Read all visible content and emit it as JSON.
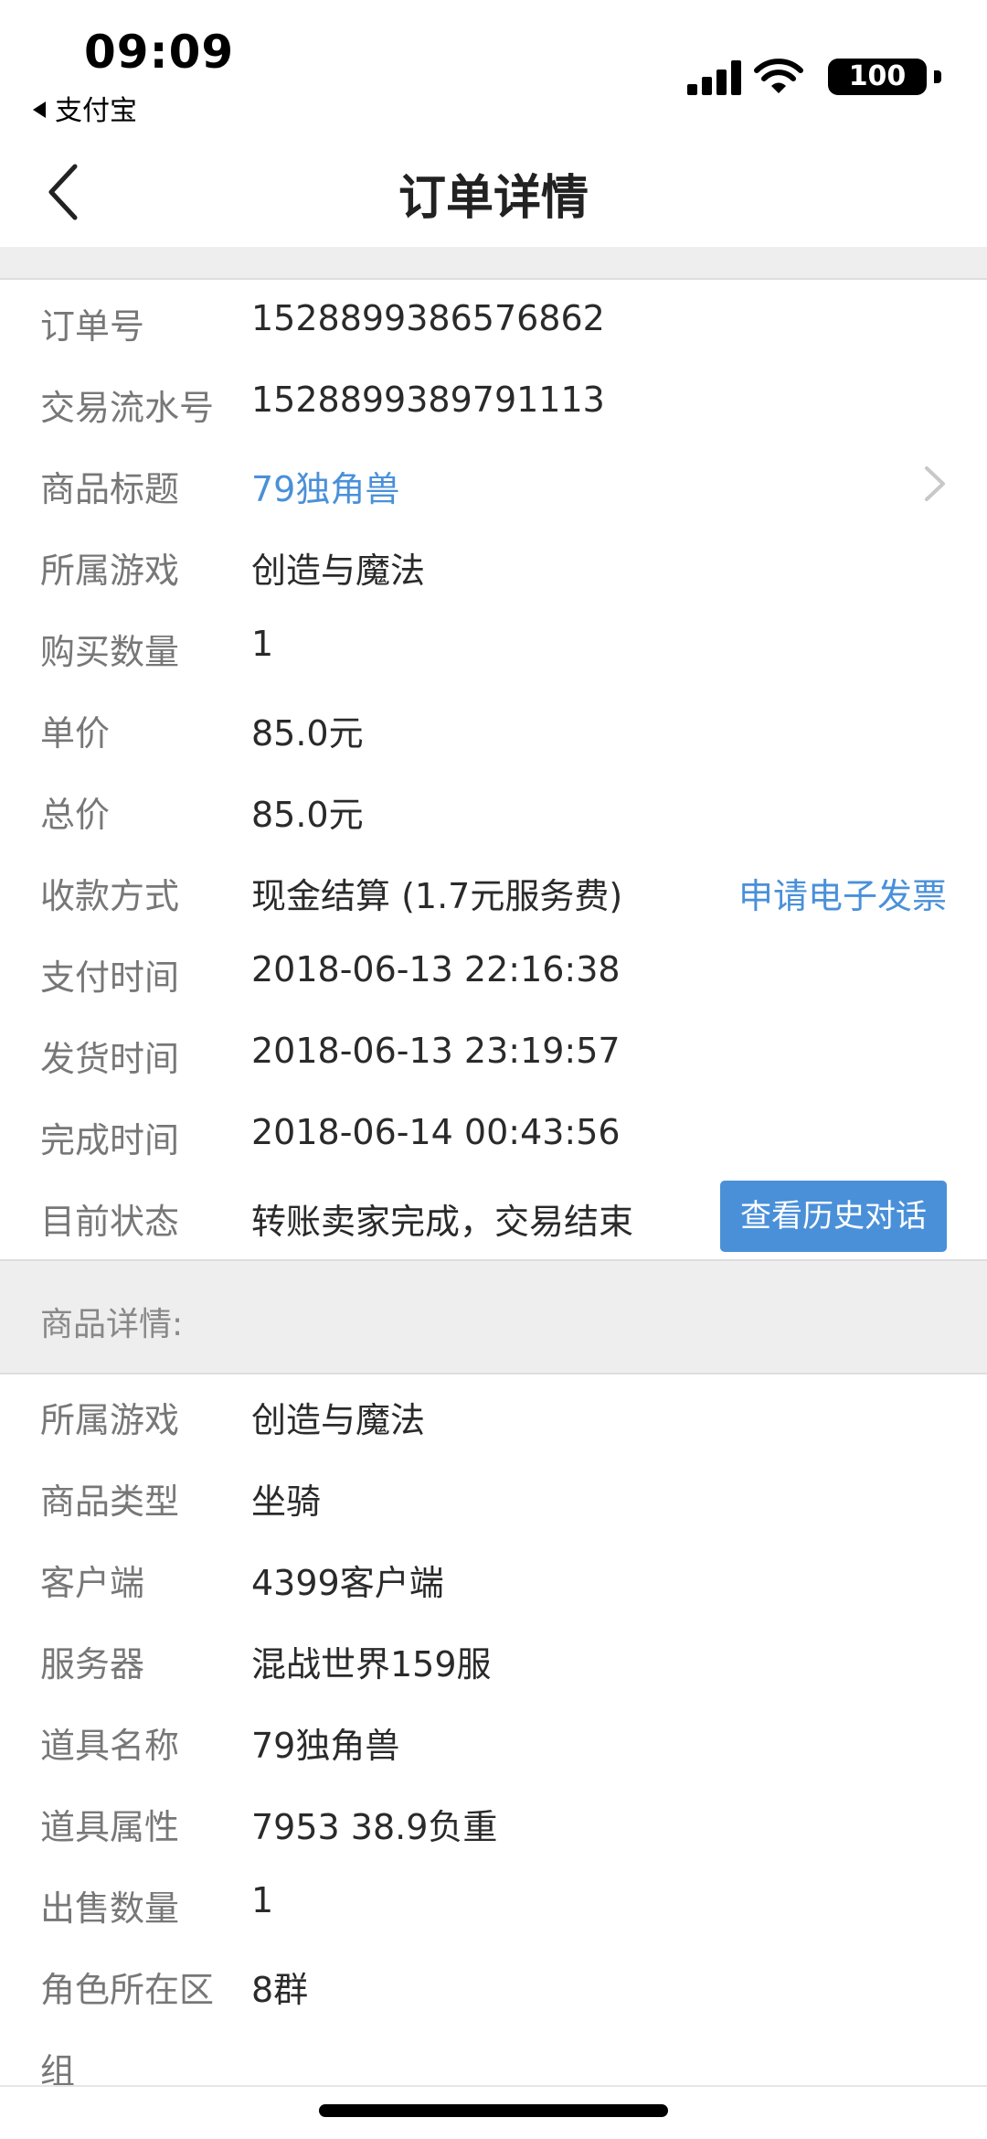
{
  "status_bar": {
    "time": "09:09",
    "back_app": "支付宝",
    "battery": "100"
  },
  "nav": {
    "title": "订单详情"
  },
  "order": {
    "order_no": {
      "label": "订单号",
      "value": "1528899386576862"
    },
    "serial_no": {
      "label": "交易流水号",
      "value": "1528899389791113"
    },
    "title": {
      "label": "商品标题",
      "value": "79独角兽"
    },
    "game": {
      "label": "所属游戏",
      "value": "创造与魔法"
    },
    "quantity": {
      "label": "购买数量",
      "value": "1"
    },
    "unit_price": {
      "label": "单价",
      "value": "85.0元"
    },
    "total_price": {
      "label": "总价",
      "value": "85.0元"
    },
    "payment": {
      "label": "收款方式",
      "value": "现金结算 (1.7元服务费)",
      "action": "申请电子发票"
    },
    "pay_time": {
      "label": "支付时间",
      "value": "2018-06-13 22:16:38"
    },
    "ship_time": {
      "label": "发货时间",
      "value": "2018-06-13 23:19:57"
    },
    "finish_time": {
      "label": "完成时间",
      "value": "2018-06-14 00:43:56"
    },
    "status": {
      "label": "目前状态",
      "value": "转账卖家完成，交易结束",
      "action": "查看历史对话"
    }
  },
  "details": {
    "section_title": "商品详情:",
    "game": {
      "label": "所属游戏",
      "value": "创造与魔法"
    },
    "type": {
      "label": "商品类型",
      "value": "坐骑"
    },
    "client": {
      "label": "客户端",
      "value": "4399客户端"
    },
    "server": {
      "label": "服务器",
      "value": "混战世界159服"
    },
    "item_name": {
      "label": "道具名称",
      "value": "79独角兽"
    },
    "item_attr": {
      "label": "道具属性",
      "value": "7953 38.9负重"
    },
    "sell_qty": {
      "label": "出售数量",
      "value": "1"
    },
    "region": {
      "label": "角色所在区",
      "label_overflow": "组",
      "value": "8群"
    }
  },
  "colors": {
    "link": "#4a90d9",
    "label": "#777777",
    "section_bg": "#eeeeee"
  }
}
